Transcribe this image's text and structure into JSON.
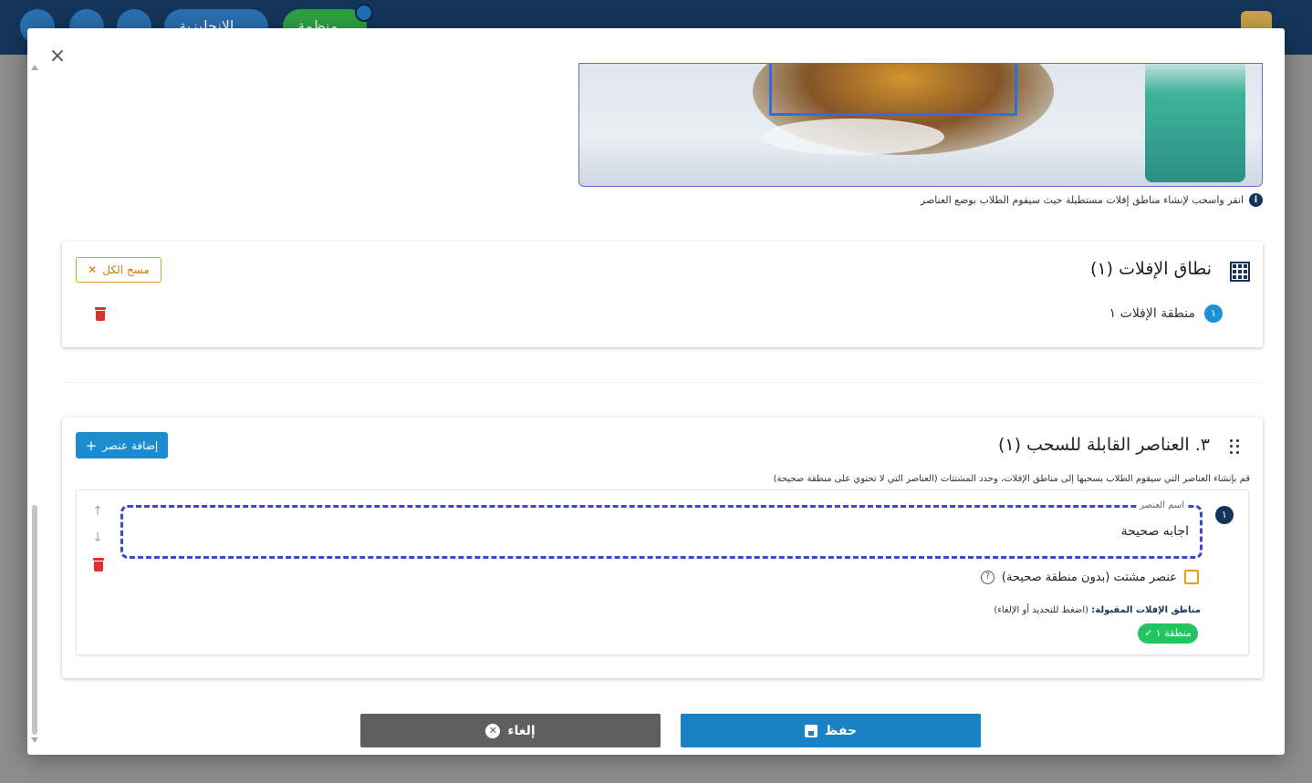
{
  "header": {
    "language_label": "الإنجليزية",
    "status_label": "منظمة"
  },
  "modal": {
    "close_symbol": "×"
  },
  "image_area": {
    "hint": "انقر واسحب لإنشاء مناطق إفلات مستطيلة حيث سيقوم الطلاب بوضع العناصر",
    "info_symbol": "i"
  },
  "drop_zones": {
    "title": "نطاق الإفلات (١)",
    "clear_all_label": "مسح الكل",
    "zones": [
      {
        "badge": "١",
        "label": "منطقة الإفلات ١"
      }
    ]
  },
  "draggable_items": {
    "title": "٣. العناصر القابلة للسحب (١)",
    "add_label": "إضافة عنصر",
    "description": "قم بإنشاء العناصر التي سيقوم الطلاب بسحبها إلى مناطق الإفلات، وحدد المشتتات (العناصر التي لا تحتوي على منطقة صحيحة)",
    "items": [
      {
        "index": "١",
        "field_label": "اسم العنصر",
        "value": "اجابه صحيحة",
        "distractor_label": "عنصر مشتت (بدون منطقة صحيحة)",
        "distractor_checked": false,
        "accepted_zones_title": "مناطق الإفلات المقبولة:",
        "accepted_zones_hint": "(اضغط للتحديد أو الإلغاء)",
        "zone_chip": "منطقة ١ ✓"
      }
    ]
  },
  "footer": {
    "save_label": "حفظ",
    "cancel_label": "إلغاء"
  },
  "colors": {
    "primary": "#1a82c4",
    "navy": "#14355a",
    "danger": "#e03131",
    "warning": "#e0a020",
    "success": "#23c55e"
  }
}
